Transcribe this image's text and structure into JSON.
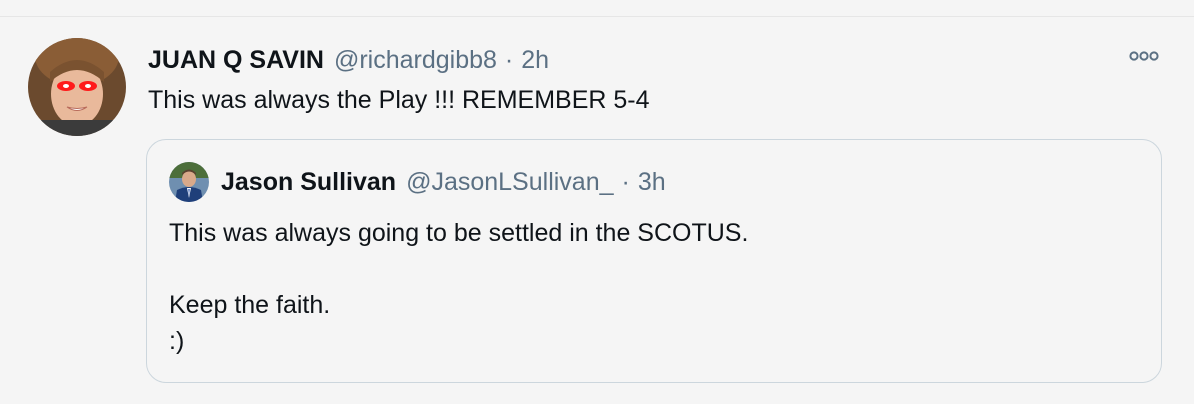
{
  "tweet": {
    "author_name": "JUAN Q SAVIN",
    "author_handle": "@richardgibb8",
    "separator": "·",
    "time": "2h",
    "text": "This was always the Play !!! REMEMBER 5-4",
    "avatar_icon": "profile-photo-glowing-red-eyes",
    "more_icon": "more-options-icon"
  },
  "quote": {
    "author_name": "Jason Sullivan",
    "author_handle": "@JasonLSullivan_",
    "separator": "·",
    "time": "3h",
    "lines": [
      "This was always going to be settled in the SCOTUS.",
      "",
      "Keep the faith.",
      ":)"
    ],
    "avatar_icon": "profile-photo"
  },
  "colors": {
    "background": "#f5f5f5",
    "text": "#0f1419",
    "secondary_text": "#5b7083",
    "border": "#ccd6dd"
  }
}
